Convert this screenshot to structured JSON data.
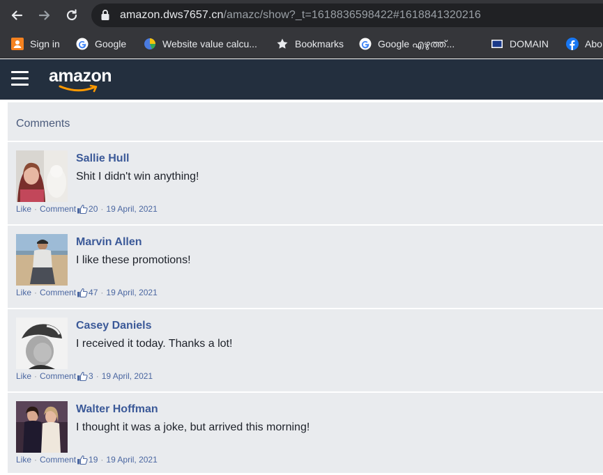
{
  "browser": {
    "url_host": "amazon.dws7657.cn",
    "url_path": "/amazc/show?_t=1618836598422#1618841320216",
    "bookmarks": [
      {
        "label": "Sign in",
        "icon": "signin-icon"
      },
      {
        "label": "Google",
        "icon": "google-icon"
      },
      {
        "label": "Website value calcu...",
        "icon": "pie-icon"
      },
      {
        "label": "Bookmarks",
        "icon": "star-icon"
      },
      {
        "label": "Google എഴുത്ത്...",
        "icon": "google-icon"
      },
      {
        "label": "DOMAIN",
        "icon": "domain-icon"
      },
      {
        "label": "Abo",
        "icon": "facebook-icon"
      }
    ]
  },
  "header": {
    "logo_text": "amazon"
  },
  "comments_section": {
    "title": "Comments",
    "like_label": "Like",
    "comment_label": "Comment",
    "items": [
      {
        "name": "Sallie Hull",
        "text": "Shit I didn't win anything!",
        "likes": "20",
        "date": "19 April, 2021"
      },
      {
        "name": "Marvin Allen",
        "text": "I like these promotions!",
        "likes": "47",
        "date": "19 April, 2021"
      },
      {
        "name": "Casey Daniels",
        "text": "I received it today. Thanks a lot!",
        "likes": "3",
        "date": "19 April, 2021"
      },
      {
        "name": "Walter Hoffman",
        "text": "I thought it was a joke, but arrived this morning!",
        "likes": "19",
        "date": "19 April, 2021"
      }
    ]
  },
  "colors": {
    "chrome_bg": "#35363a",
    "amazon_header": "#232f3e",
    "comments_bg": "#e9ebee",
    "name_blue": "#3b5998",
    "meta_blue": "#4b67a1"
  }
}
